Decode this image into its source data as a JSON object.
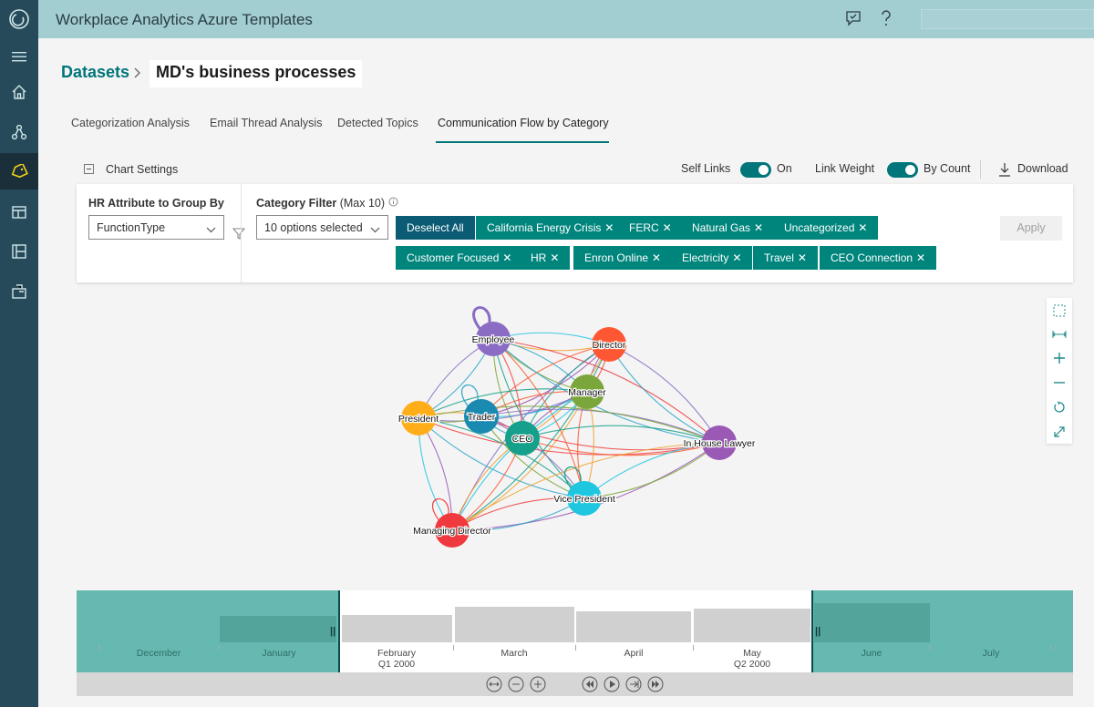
{
  "app": {
    "title": "Workplace Analytics Azure Templates"
  },
  "breadcrumb": {
    "parent": "Datasets",
    "current": "MD's business processes"
  },
  "tabs": [
    {
      "label": "Categorization Analysis"
    },
    {
      "label": "Email Thread Analysis"
    },
    {
      "label": "Detected Topics"
    },
    {
      "label": "Communication Flow by Category",
      "active": true
    }
  ],
  "chart_settings": {
    "label": "Chart Settings",
    "self_links_label": "Self Links",
    "self_links_value": "On",
    "link_weight_label": "Link Weight",
    "link_weight_value": "By Count",
    "download_label": "Download"
  },
  "filters": {
    "hr_attribute_label": "HR Attribute to Group By",
    "hr_attribute_value": "FunctionType",
    "category_filter_label": "Category Filter",
    "category_filter_max": "(Max 10)",
    "category_filter_value": "10 options selected",
    "deselect_all": "Deselect All",
    "chips": [
      "California Energy Crisis",
      "FERC",
      "Natural Gas",
      "Uncategorized",
      "Customer Focused",
      "HR",
      "Enron Online",
      "Electricity",
      "Travel",
      "CEO Connection"
    ],
    "apply": "Apply"
  },
  "graph": {
    "nodes": [
      {
        "id": "employee",
        "label": "Employee",
        "color": "#8a6cc4"
      },
      {
        "id": "director",
        "label": "Director",
        "color": "#ff5733"
      },
      {
        "id": "manager",
        "label": "Manager",
        "color": "#7ba63b"
      },
      {
        "id": "president",
        "label": "President",
        "color": "#ffae1a"
      },
      {
        "id": "trader",
        "label": "Trader",
        "color": "#1a8ab0"
      },
      {
        "id": "ceo",
        "label": "CEO",
        "color": "#14a08a"
      },
      {
        "id": "lawyer",
        "label": "In House Lawyer",
        "color": "#9b59b6"
      },
      {
        "id": "vp",
        "label": "Vice President",
        "color": "#1ec6e0"
      },
      {
        "id": "md",
        "label": "Managing Director",
        "color": "#f0393f"
      }
    ]
  },
  "timeline": {
    "months": [
      {
        "label": "December"
      },
      {
        "label": "January"
      },
      {
        "label": "February",
        "sub": "Q1  2000"
      },
      {
        "label": "March"
      },
      {
        "label": "April"
      },
      {
        "label": "May",
        "sub": "Q2  2000"
      },
      {
        "label": "June"
      },
      {
        "label": "July"
      }
    ]
  }
}
